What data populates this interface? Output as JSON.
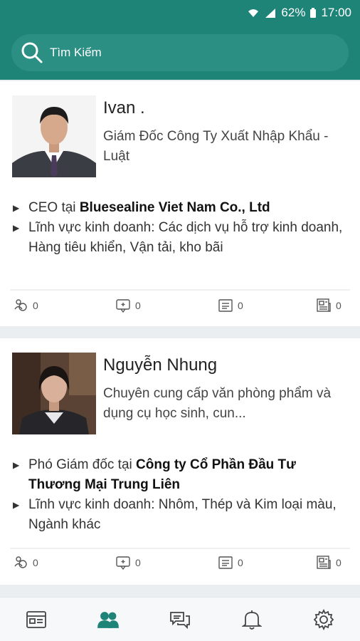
{
  "status_bar": {
    "battery": "62%",
    "time": "17:00"
  },
  "search": {
    "placeholder": "Tìm Kiếm"
  },
  "contacts": [
    {
      "name": "Ivan .",
      "headline": "Giám Đốc Công Ty  Xuất Nhập Khẩu - Luật",
      "role_prefix": "CEO tại ",
      "company": "Bluesealine Viet Nam Co., Ltd",
      "industry": "Lĩnh vực kinh doanh: Các dịch vụ hỗ trợ kinh doanh, Hàng tiêu khiển, Vận tải, kho bãi",
      "stats": {
        "connections": "0",
        "messages": "0",
        "profile": "0",
        "news": "0"
      }
    },
    {
      "name": "Nguyễn Nhung",
      "headline": "Chuyên cung cấp văn phòng phẩm và dụng cụ học sinh, cun...",
      "role_prefix": "Phó Giám đốc tại ",
      "company": "Công ty Cổ Phần Đầu Tư Thương Mại Trung Liên",
      "industry": "Lĩnh vực kinh doanh: Nhôm, Thép và Kim loại màu, Ngành khác",
      "stats": {
        "connections": "0",
        "messages": "0",
        "profile": "0",
        "news": "0"
      }
    }
  ],
  "bottom_nav": [
    "news-feed-icon",
    "contacts-icon",
    "chat-icon",
    "bell-icon",
    "settings-icon"
  ],
  "colors": {
    "primary": "#1f8478",
    "search_bg": "#2b8f83"
  }
}
